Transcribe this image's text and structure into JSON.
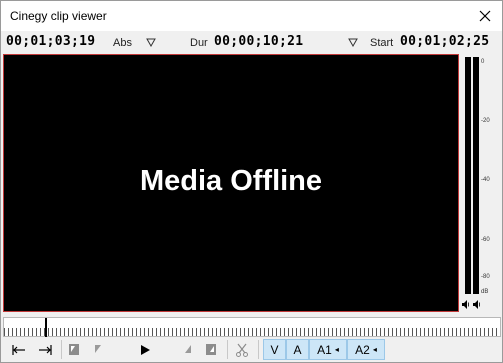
{
  "window": {
    "title": "Cinegy clip viewer"
  },
  "timecode_bar": {
    "abs_timecode": "00;01;03;19",
    "abs_label": "Abs",
    "dur_label": "Dur",
    "dur_timecode": "00;00;10;21",
    "start_label": "Start",
    "start_timecode": "00;01;02;25"
  },
  "video": {
    "overlay_text": "Media Offline",
    "border_color": "#c23a3a"
  },
  "audio_meter": {
    "ticks": [
      "0",
      "-20",
      "-40",
      "-60",
      "-80",
      "dB"
    ]
  },
  "icons": {
    "close": "close-icon",
    "go_to_in": "go-to-in-icon",
    "go_to_out": "go-to-out-icon",
    "mark_in": "mark-in-icon",
    "mark_out": "mark-out-icon",
    "play": "play-icon",
    "cut": "scissors-icon",
    "speaker": "speaker-icon"
  },
  "tracks": {
    "video": "V",
    "audio": "A",
    "a1": "A1",
    "a2": "A2"
  },
  "colors": {
    "track_active_bg": "#cde6f7",
    "video_bg": "#000000"
  }
}
